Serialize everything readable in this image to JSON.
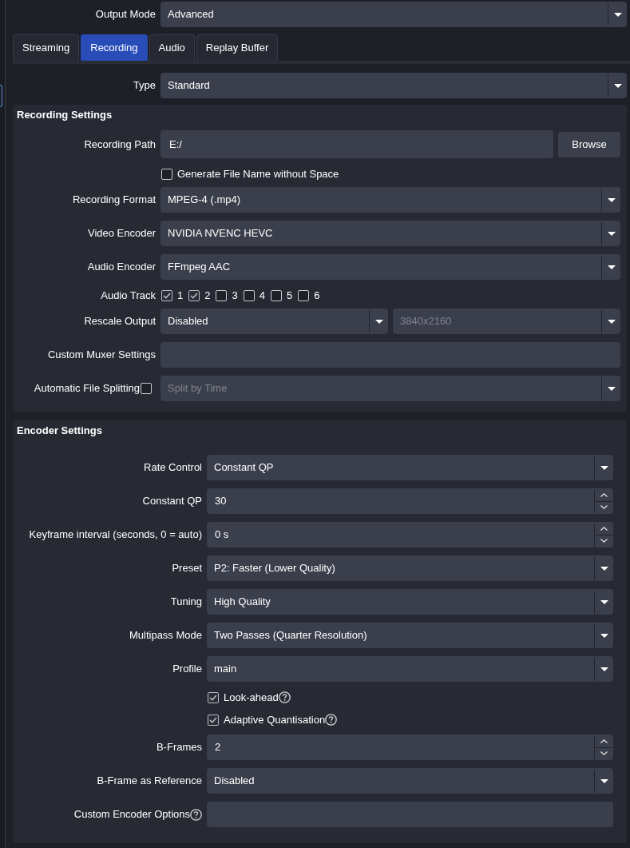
{
  "output_mode": {
    "label": "Output Mode",
    "value": "Advanced"
  },
  "tabs": [
    {
      "label": "Streaming",
      "selected": false
    },
    {
      "label": "Recording",
      "selected": true
    },
    {
      "label": "Audio",
      "selected": false
    },
    {
      "label": "Replay Buffer",
      "selected": false
    }
  ],
  "type": {
    "label": "Type",
    "value": "Standard"
  },
  "recording_settings": {
    "title": "Recording Settings",
    "rows": [
      {
        "kind": "path",
        "label": "Recording Path",
        "value": "E:/",
        "button": "Browse"
      },
      {
        "kind": "checkbox",
        "label": "Generate File Name without Space",
        "checked": false
      },
      {
        "kind": "select",
        "label": "Recording Format",
        "value": "MPEG-4 (.mp4)"
      },
      {
        "kind": "select",
        "label": "Video Encoder",
        "value": "NVIDIA NVENC HEVC"
      },
      {
        "kind": "select",
        "label": "Audio Encoder",
        "value": "FFmpeg AAC"
      },
      {
        "kind": "tracks",
        "label": "Audio Track",
        "tracks": [
          {
            "label": "1",
            "checked": true
          },
          {
            "label": "2",
            "checked": true
          },
          {
            "label": "3",
            "checked": false
          },
          {
            "label": "4",
            "checked": false
          },
          {
            "label": "5",
            "checked": false
          },
          {
            "label": "6",
            "checked": false
          }
        ]
      },
      {
        "kind": "dual_select",
        "label": "Rescale Output",
        "selects": [
          {
            "value": "Disabled",
            "disabled": false
          },
          {
            "value": "3840x2160",
            "disabled": true
          }
        ]
      },
      {
        "kind": "input",
        "label": "Custom Muxer Settings"
      },
      {
        "kind": "check_select",
        "label": "Automatic File Splitting",
        "checked": false,
        "value": "Split by Time",
        "disabled": true
      }
    ]
  },
  "encoder_settings": {
    "title": "Encoder Settings",
    "rows": [
      {
        "kind": "select",
        "label": "Rate Control",
        "value": "Constant QP"
      },
      {
        "kind": "spin",
        "label": "Constant QP",
        "value": "30"
      },
      {
        "kind": "spin",
        "label": "Keyframe interval (seconds, 0 = auto)",
        "value": "0 s"
      },
      {
        "kind": "select",
        "label": "Preset",
        "value": "P2: Faster (Lower Quality)"
      },
      {
        "kind": "select",
        "label": "Tuning",
        "value": "High Quality"
      },
      {
        "kind": "select",
        "label": "Multipass Mode",
        "value": "Two Passes (Quarter Resolution)"
      },
      {
        "kind": "select",
        "label": "Profile",
        "value": "main"
      },
      {
        "kind": "checkbox",
        "label": "Look-ahead",
        "checked": true,
        "help": true
      },
      {
        "kind": "checkbox",
        "label": "Adaptive Quantisation",
        "checked": true,
        "help": true
      },
      {
        "kind": "spin",
        "label": "B-Frames",
        "value": "2"
      },
      {
        "kind": "select",
        "label": "B-Frame as Reference",
        "value": "Disabled"
      },
      {
        "kind": "input",
        "label": "Custom Encoder Options",
        "help": true
      }
    ]
  }
}
